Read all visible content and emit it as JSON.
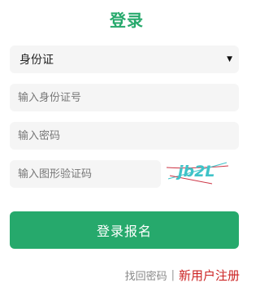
{
  "title": "登录",
  "id_type_select": {
    "selected": "身份证"
  },
  "id_number_input": {
    "placeholder": "输入身份证号",
    "value": ""
  },
  "password_input": {
    "placeholder": "输入密码",
    "value": ""
  },
  "captcha_input": {
    "placeholder": "输入图形验证码",
    "value": ""
  },
  "captcha_image": {
    "text": "jb2L"
  },
  "submit_label": "登录报名",
  "links": {
    "forgot_password": "找回密码",
    "separator": "|",
    "register": "新用户注册"
  },
  "colors": {
    "accent": "#26a96c",
    "register_link": "#cc2222",
    "field_background": "#f5f5f5",
    "captcha_text": "#3fc3c8",
    "captcha_noise": "#cc3344"
  }
}
